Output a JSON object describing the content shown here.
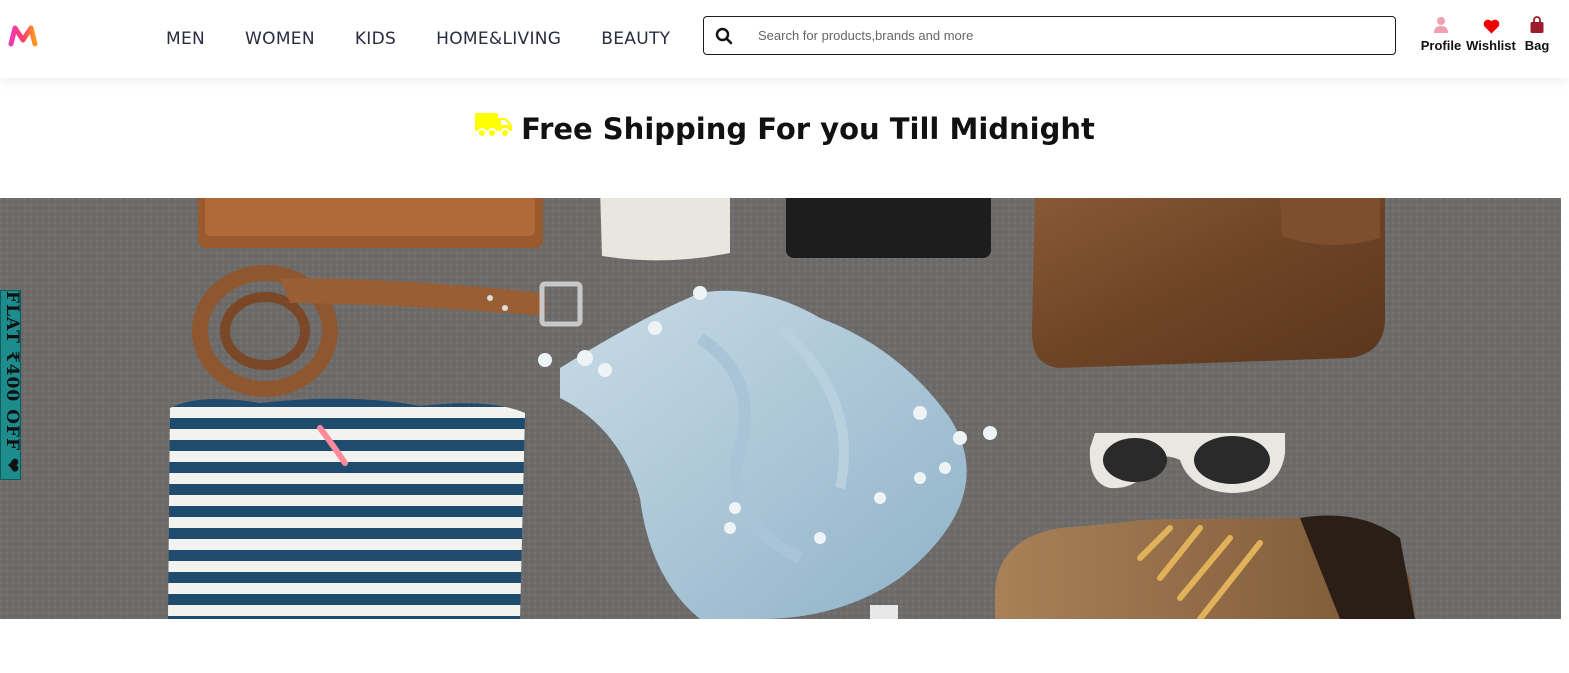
{
  "header": {
    "logo_icon": "myntra-logo-icon",
    "nav": [
      {
        "label": "MEN"
      },
      {
        "label": "WOMEN"
      },
      {
        "label": "KIDS"
      },
      {
        "label": "HOME&LIVING"
      },
      {
        "label": "BEAUTY"
      }
    ],
    "search": {
      "icon": "search-icon",
      "placeholder": "Search for products,brands and more",
      "value": ""
    },
    "actions": [
      {
        "label": "Profile",
        "icon": "person-icon",
        "color": "#f0a0b0"
      },
      {
        "label": "Wishlist",
        "icon": "heart-icon",
        "color": "#ee0000"
      },
      {
        "label": "Bag",
        "icon": "bag-icon",
        "color": "#9b1c2c"
      }
    ]
  },
  "banner": {
    "shipping_text": "Free Shipping For you Till Midnight",
    "truck_icon": "truck-icon",
    "truck_color": "#ffff00"
  },
  "side_tab": {
    "text": "FLAT ₹400 OFF ❤",
    "color": "#1c8c8c"
  },
  "hero": {
    "image": "fashion-accessories-flatlay"
  }
}
